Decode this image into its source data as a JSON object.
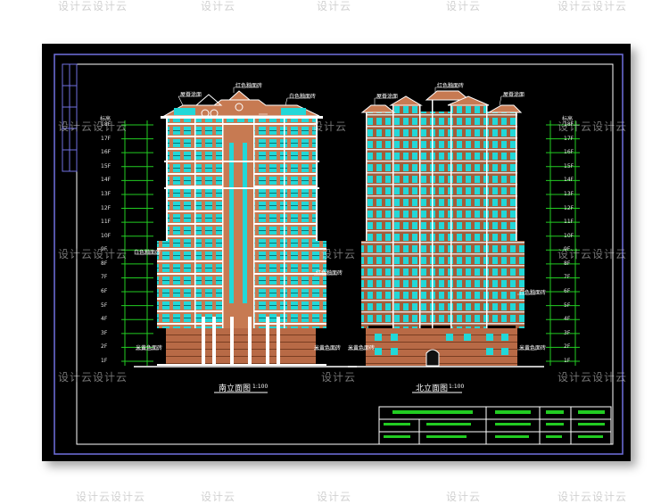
{
  "watermark": "设计云设计云",
  "watermark_short": "设计云",
  "drawings": {
    "left_title": "南立面图",
    "left_scale": "1:100",
    "right_title": "北立面图",
    "right_scale": "1:100"
  },
  "annotations": {
    "roof_label": "屋脊涂面",
    "color_tile_a": "红色釉面砖",
    "color_tile_b": "白色釉面砖",
    "base_stone": "米黄色面砖",
    "elev_header": "标高"
  },
  "floor_labels": [
    "18F",
    "17F",
    "16F",
    "15F",
    "14F",
    "13F",
    "12F",
    "11F",
    "10F",
    "9F",
    "8F",
    "7F",
    "6F",
    "5F",
    "4F",
    "3F",
    "2F",
    "1F"
  ],
  "colors": {
    "background": "#000000",
    "border": "#7070e0",
    "facade": "#c77a52",
    "window": "#22d8d8",
    "trim": "#ffffff",
    "dimension": "#22cc22",
    "text": "#ffffff"
  }
}
